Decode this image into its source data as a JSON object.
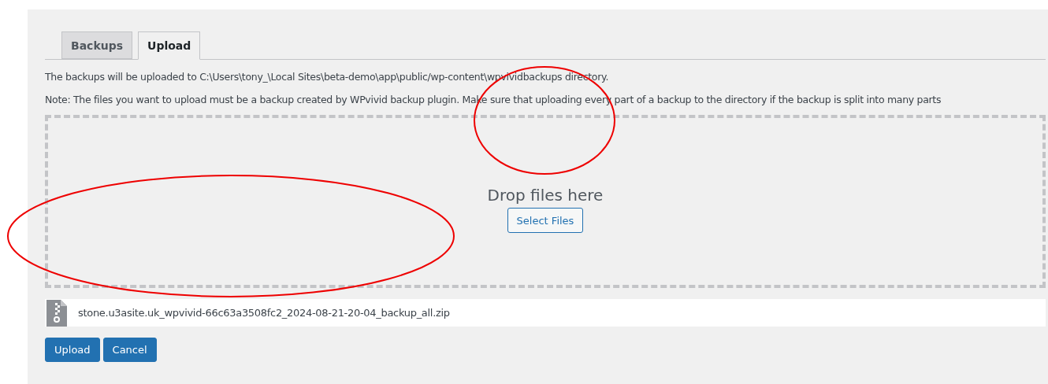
{
  "tabs": [
    {
      "label": "Backups",
      "selected": false
    },
    {
      "label": "Upload",
      "selected": true
    }
  ],
  "info": [
    "The backups will be uploaded to C:\\Users\\tony_\\Local Sites\\beta-demo\\app\\public/wp-content\\wpvividbackups directory.",
    "Note: The files you want to upload must be a backup created by WPvivid backup plugin. Make sure that uploading every part of a backup to the directory if the backup is split into many parts"
  ],
  "dropzone": {
    "text": "Drop files here",
    "button": "Select Files"
  },
  "files": [
    {
      "name": "stone.u3asite.uk_wpvivid-66c63a3508fc2_2024-08-21-20-04_backup_all.zip"
    }
  ],
  "buttons": [
    "Upload",
    "Cancel"
  ],
  "markup": [
    {
      "kind": "ellipse"
    },
    {
      "kind": "ellipse"
    }
  ]
}
